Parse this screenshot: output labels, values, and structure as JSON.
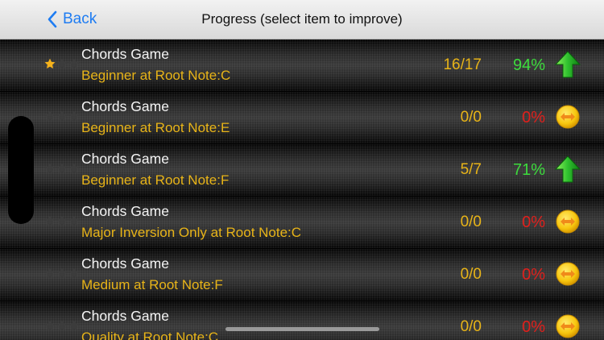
{
  "navbar": {
    "back_label": "Back",
    "title": "Progress (select item to improve)"
  },
  "colors": {
    "accent_blue": "#1e7cf2",
    "subtitle_gold": "#e8b418",
    "good_green": "#3ddc3d",
    "bad_red": "#e0201c",
    "star_gold": "#f5b21c",
    "star_empty": "#3c3c3c"
  },
  "rows": [
    {
      "title": "Chords Game",
      "subtitle": "Beginner at Root Note:C",
      "score": "16/17",
      "percent": "94%",
      "stars": 1,
      "trend": "up-arrow-icon"
    },
    {
      "title": "Chords Game",
      "subtitle": "Beginner at Root Note:E",
      "score": "0/0",
      "percent": "0%",
      "stars": 0,
      "trend": "improve-coin-icon"
    },
    {
      "title": "Chords Game",
      "subtitle": "Beginner at Root Note:F",
      "score": "5/7",
      "percent": "71%",
      "stars": 0,
      "trend": "up-arrow-icon"
    },
    {
      "title": "Chords Game",
      "subtitle": "Major Inversion Only at Root Note:C",
      "score": "0/0",
      "percent": "0%",
      "stars": 0,
      "trend": "improve-coin-icon"
    },
    {
      "title": "Chords Game",
      "subtitle": "Medium at Root Note:F",
      "score": "0/0",
      "percent": "0%",
      "stars": 0,
      "trend": "improve-coin-icon"
    },
    {
      "title": "Chords Game",
      "subtitle": "Quality at Root Note:C",
      "score": "0/0",
      "percent": "0%",
      "stars": 0,
      "trend": "improve-coin-icon"
    }
  ]
}
